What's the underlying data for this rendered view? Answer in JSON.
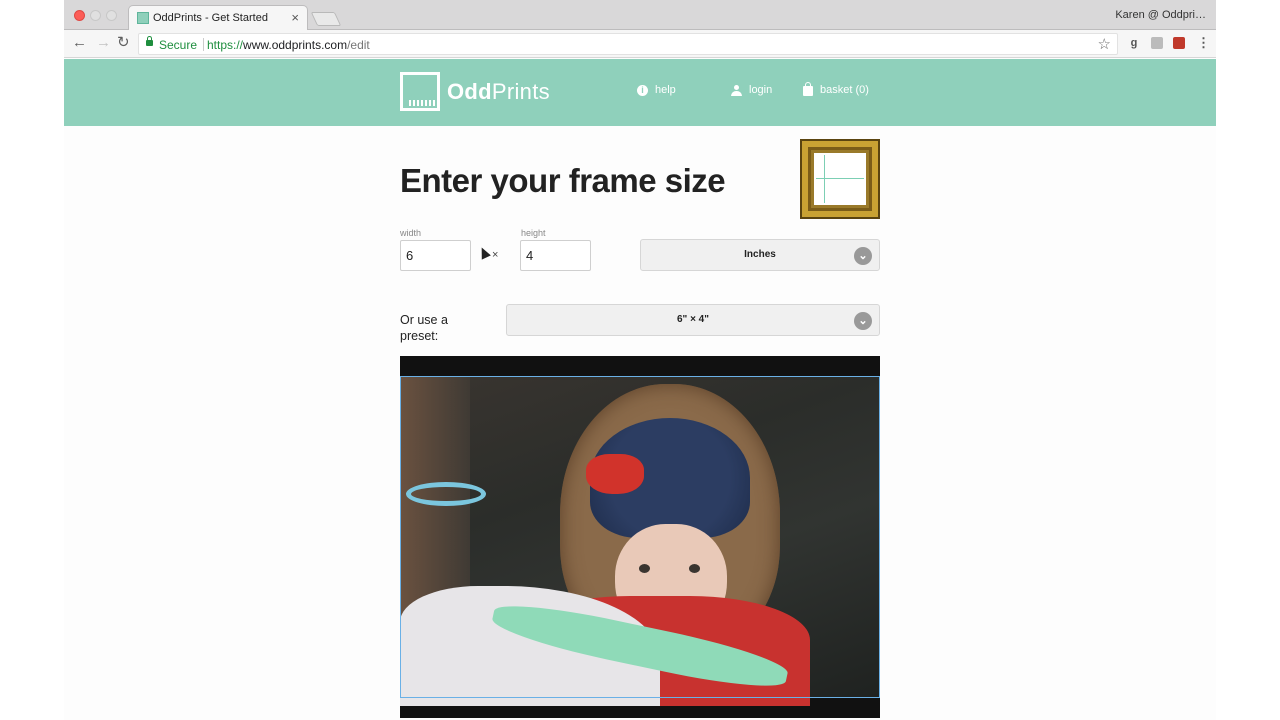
{
  "browser": {
    "tab_title": "OddPrints - Get Started",
    "tab_close": "×",
    "profile": "Karen @ Oddpri…",
    "secure_label": "Secure",
    "url_scheme": "https://",
    "url_host": "www.oddprints.com",
    "url_path": "/edit",
    "star": "☆",
    "menu": "⋮"
  },
  "header": {
    "logo_bold": "Odd",
    "logo_rest": "Prints",
    "nav": {
      "help": "help",
      "login": "login",
      "basket": "basket (0)"
    }
  },
  "main": {
    "title": "Enter your frame size",
    "width_label": "width",
    "width_value": "6",
    "height_label": "height",
    "height_value": "4",
    "times": "×",
    "units_selected": "Inches",
    "preset_label": "Or use a preset:",
    "preset_selected": "6\" × 4\""
  },
  "colors": {
    "brand": "#8fd0bb",
    "crop_border": "#6ab0e6"
  }
}
